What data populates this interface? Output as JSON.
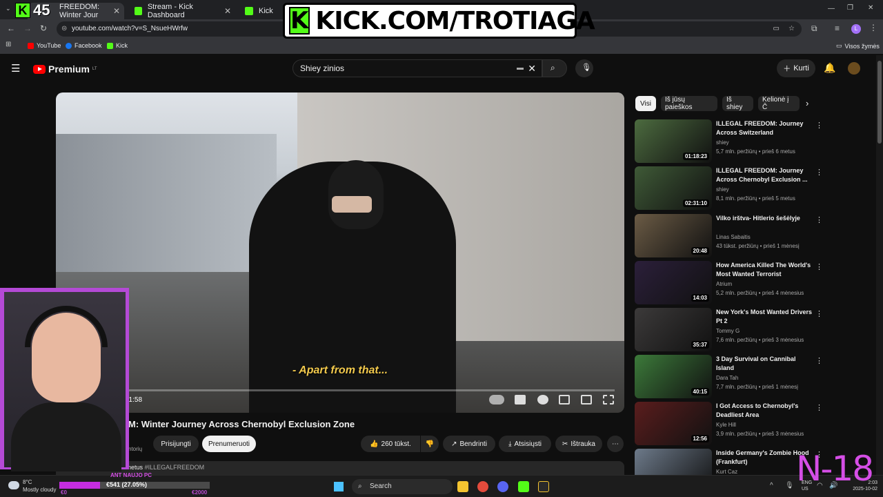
{
  "browser": {
    "tabs": [
      {
        "label": "FREEDOM: Winter Jour"
      },
      {
        "label": "Stream - Kick Dashboard"
      },
      {
        "label": "Kick"
      }
    ],
    "url": "youtube.com/watch?v=S_NsueHWrfw",
    "bookmarks": [
      "YouTube",
      "Facebook",
      "Kick"
    ],
    "other_bookmarks": "Visos žymės",
    "profile_initial": "L"
  },
  "overlay": {
    "kick_banner": "KICK.COM/TROTIAGA",
    "kick_logo": "K",
    "viewer_count": "45",
    "age_rating": "N-18",
    "donation": {
      "label": "ANT NAUJO PC",
      "progress_text": "€541 (27.05%)",
      "progress_fraction": 0.2705,
      "min": "€0",
      "max": "€2000"
    }
  },
  "youtube": {
    "logo": "Premium",
    "region": "LT",
    "search_value": "Shiey zinios",
    "create_label": "Kurti",
    "video": {
      "subtitle": "- Apart from that...",
      "time": "51:58",
      "title": "M: Winter Journey Across Chernobyl Exclusion Zone",
      "channel_sub": "ntorių",
      "join_label": "Prisijungti",
      "subscribe_label": "Prenumeruoti",
      "likes": "260 tūkst.",
      "share_label": "Bendrinti",
      "download_label": "Atsisiųsti",
      "clip_label": "Ištrauka",
      "meta_text": "1 mln. peržiūrų  prieš 3 metus",
      "meta_tag": "#ILLEGALFREEDOM"
    },
    "chips": [
      "Visi",
      "Iš jūsų paieškos",
      "Iš shiey",
      "Kelionė į Č"
    ],
    "suggestions": [
      {
        "title": "ILLEGAL FREEDOM: Journey Across Switzerland",
        "channel": "shiey",
        "stats": "5,7 mln. peržiūrų • prieš 6 metus",
        "duration": "01:18:23",
        "color": "#4c6b3f"
      },
      {
        "title": "ILLEGAL FREEDOM: Journey Across Chernobyl Exclusion ...",
        "channel": "shiey",
        "stats": "8,1 mln. peržiūrų • prieš 5 metus",
        "duration": "02:31:10",
        "color": "#3f5a37"
      },
      {
        "title": "Vilko irštva- Hitlerio šešėlyje",
        "channel": "Linas Sabaitis",
        "stats": "43 tūkst. peržiūrų • prieš 1 mėnesį",
        "duration": "20:48",
        "color": "#6b5b45"
      },
      {
        "title": "How America Killed The World's Most Wanted Terrorist",
        "channel": "Atrium",
        "stats": "5,2 mln. peržiūrų • prieš 4 mėnesius",
        "duration": "14:03",
        "color": "#2b1f3a"
      },
      {
        "title": "New York's Most Wanted Drivers Pt 2",
        "channel": "Tommy G",
        "stats": "7,6 mln. peržiūrų • prieš 3 mėnesius",
        "duration": "35:37",
        "color": "#3c3a3a"
      },
      {
        "title": "3 Day Survival on Cannibal Island",
        "channel": "Dara Tah",
        "stats": "7,7 mln. peržiūrų • prieš 1 mėnesį",
        "duration": "40:15",
        "color": "#3c7a3a"
      },
      {
        "title": "I Got Access to Chernobyl's Deadliest Area",
        "channel": "Kyle Hill",
        "stats": "3,9 mln. peržiūrų • prieš 3 mėnesius",
        "duration": "12:56",
        "color": "#5a1d1d"
      },
      {
        "title": "Inside Germany's Zombie Hood (Frankfurt)",
        "channel": "Kurt Caz",
        "stats": "",
        "duration": "",
        "color": "#6d7a8a"
      }
    ]
  },
  "taskbar": {
    "temp": "8°C",
    "weather": "Mostly cloudy",
    "search_label": "Search",
    "lang": "ENG",
    "lang2": "US",
    "time": "2:03",
    "date": "2025-10-02"
  }
}
